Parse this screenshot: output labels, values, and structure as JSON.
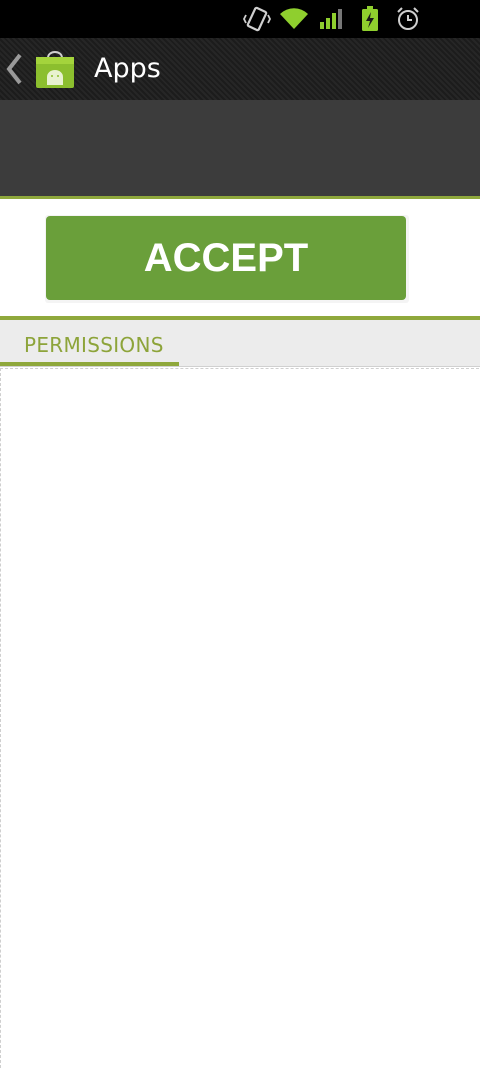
{
  "status_bar": {
    "icons": [
      "vibrate-icon",
      "wifi-icon",
      "signal-icon",
      "battery-charging-icon",
      "alarm-icon"
    ]
  },
  "action_bar": {
    "title": "Apps",
    "logo_icon": "market-bag-icon",
    "back_icon": "chevron-left-icon"
  },
  "accept_button": {
    "label": "ACCEPT"
  },
  "tabs": [
    {
      "label": "PERMISSIONS",
      "selected": true
    }
  ],
  "colors": {
    "accent": "#8fa83c",
    "button": "#6a9f3a",
    "header_bg": "#3c3c3c"
  }
}
